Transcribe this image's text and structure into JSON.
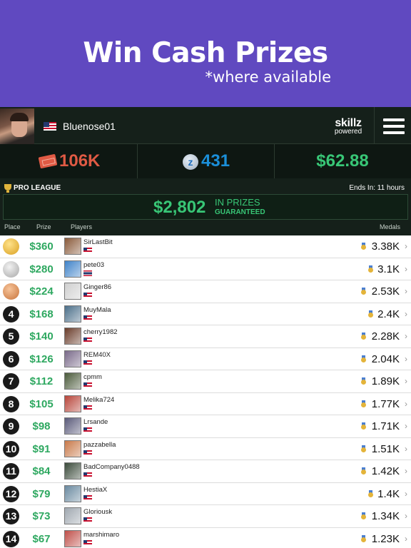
{
  "banner": {
    "title": "Win Cash Prizes",
    "subtitle": "*where available"
  },
  "header": {
    "username": "Bluenose01",
    "brand": "skillz",
    "brand_sub": "powered"
  },
  "stats": {
    "tickets": "106K",
    "z": "431",
    "cash": "$62.88",
    "z_icon": "z"
  },
  "league": {
    "name": "PRO LEAGUE",
    "ends": "Ends In: 11 hours",
    "prize_amount": "$2,802",
    "prize_in": "IN PRIZES",
    "prize_guaranteed": "GUARANTEED",
    "columns": {
      "place": "Place",
      "prize": "Prize",
      "players": "Players",
      "medals": "Medals"
    }
  },
  "rows": [
    {
      "place": "",
      "prize": "$360",
      "name": "SirLastBit",
      "medals": "3.38K",
      "flag": "us",
      "avatar": "#8a5a3a"
    },
    {
      "place": "",
      "prize": "$280",
      "name": "pete03",
      "medals": "3.1K",
      "flag": "th",
      "avatar": "#3f83c9"
    },
    {
      "place": "",
      "prize": "$224",
      "name": "Ginger86",
      "medals": "2.53K",
      "flag": "us",
      "avatar": "#cfcfcf"
    },
    {
      "place": "4",
      "prize": "$168",
      "name": "MuyMala",
      "medals": "2.4K",
      "flag": "us",
      "avatar": "#4b6f8a"
    },
    {
      "place": "5",
      "prize": "$140",
      "name": "cherry1982",
      "medals": "2.28K",
      "flag": "us",
      "avatar": "#6a3c2a"
    },
    {
      "place": "6",
      "prize": "$126",
      "name": "REM40X",
      "medals": "2.04K",
      "flag": "us",
      "avatar": "#7a6a8a"
    },
    {
      "place": "7",
      "prize": "$112",
      "name": "cpmm",
      "medals": "1.89K",
      "flag": "us",
      "avatar": "#4a5a3a"
    },
    {
      "place": "8",
      "prize": "$105",
      "name": "Melika724",
      "medals": "1.77K",
      "flag": "us",
      "avatar": "#b8453a"
    },
    {
      "place": "9",
      "prize": "$98",
      "name": "Lrsande",
      "medals": "1.71K",
      "flag": "us",
      "avatar": "#5a5a7a"
    },
    {
      "place": "10",
      "prize": "$91",
      "name": "pazzabella",
      "medals": "1.51K",
      "flag": "us",
      "avatar": "#c97a4a"
    },
    {
      "place": "11",
      "prize": "$84",
      "name": "BadCompany0488",
      "medals": "1.42K",
      "flag": "us",
      "avatar": "#3a4a3a"
    },
    {
      "place": "12",
      "prize": "$79",
      "name": "HestiaX",
      "medals": "1.4K",
      "flag": "us",
      "avatar": "#6a8aa0"
    },
    {
      "place": "13",
      "prize": "$73",
      "name": "Gloriousk",
      "medals": "1.34K",
      "flag": "us",
      "avatar": "#a0a8b0"
    },
    {
      "place": "14",
      "prize": "$67",
      "name": "marshimaro",
      "medals": "1.23K",
      "flag": "us",
      "avatar": "#c0504a"
    }
  ]
}
